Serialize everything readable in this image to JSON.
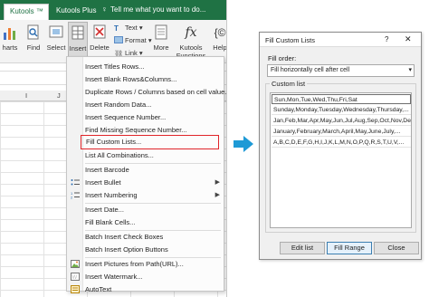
{
  "excel": {
    "tabs": [
      "Kutools ™",
      "Kutools Plus"
    ],
    "tell_me": "Tell me what you want to do...",
    "ribbon": {
      "charts": "harts",
      "find": "Find",
      "select": "Select",
      "insert": "Insert",
      "delete": "Delete",
      "text": "Text",
      "format": "Format",
      "link": "Link",
      "more": "More",
      "kutools_functions": "Kutools Functions",
      "help": "Help"
    },
    "columns": [
      "I",
      "J"
    ]
  },
  "menu": {
    "items": [
      "Insert Titles Rows...",
      "Insert Blank Rows&Columns...",
      "Duplicate Rows / Columns based on cell value...",
      "Insert Random Data...",
      "Insert Sequence Number...",
      "Find Missing Sequence Number...",
      "Fill Custom Lists...",
      "List All Combinations...",
      "Insert Barcode",
      "Insert Bullet",
      "Insert Numbering",
      "Insert Date...",
      "Fill Blank Cells...",
      "Batch Insert Check Boxes",
      "Batch Insert Option Buttons",
      "Insert Pictures from Path(URL)...",
      "Insert Watermark...",
      "AutoText"
    ]
  },
  "dialog": {
    "title": "Fill Custom Lists",
    "help": "?",
    "close": "✕",
    "fill_order_label": "Fill order:",
    "fill_order_value": "Fill horizontally cell after cell",
    "custom_list_label": "Custom list",
    "custom_lists": [
      "Sun,Mon,Tue,Wed,Thu,Fri,Sat",
      "Sunday,Monday,Tuesday,Wednesday,Thursday,...",
      "Jan,Feb,Mar,Apr,May,Jun,Jul,Aug,Sep,Oct,Nov,Dec",
      "January,February,March,April,May,June,July,...",
      "A,B,C,D,E,F,G,H,I,J,K,L,M,N,O,P,Q,R,S,T,U,V,..."
    ],
    "buttons": {
      "edit_list": "Edit list",
      "fill_range": "Fill Range",
      "close": "Close"
    }
  },
  "colors": {
    "excel_green": "#1f7244",
    "highlight_red": "#e0252a",
    "arrow_blue": "#1e9ad6"
  }
}
